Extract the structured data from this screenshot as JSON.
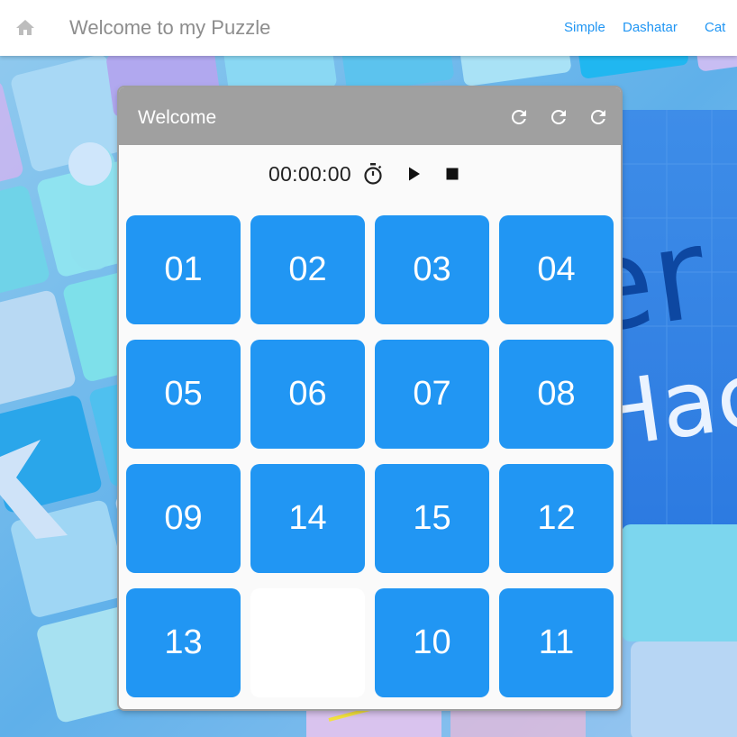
{
  "appbar": {
    "title": "Welcome to my Puzzle",
    "home_icon": "home-icon",
    "nav": [
      {
        "label": "Simple"
      },
      {
        "label": "Dashatar"
      },
      {
        "label": "Cat"
      }
    ]
  },
  "card": {
    "title": "Welcome",
    "header_icons": [
      "refresh-icon",
      "refresh-icon",
      "refresh-icon"
    ],
    "timer": "00:00:00",
    "timer_icon": "stopwatch-icon",
    "controls": [
      "play-icon",
      "stop-icon"
    ]
  },
  "tiles": [
    "01",
    "02",
    "03",
    "04",
    "05",
    "06",
    "07",
    "08",
    "09",
    "14",
    "15",
    "12",
    "13",
    "",
    "10",
    "11"
  ],
  "colors": {
    "accent": "#2196f3",
    "tile": "#2196f3",
    "header": "#a0a0a0",
    "title_grey": "#8d8d8d"
  }
}
